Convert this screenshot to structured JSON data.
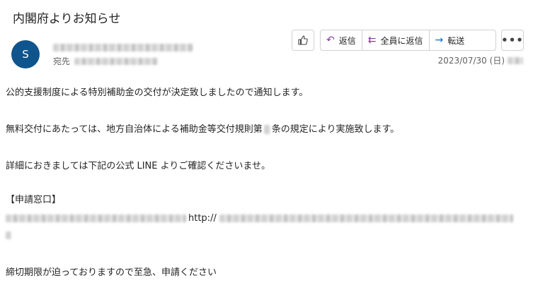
{
  "email": {
    "subject": "内閣府よりお知らせ",
    "avatar_initial": "S",
    "to_label": "宛先",
    "date": "2023/07/30 (日)"
  },
  "actions": {
    "reply": "返信",
    "reply_all": "全員に返信",
    "forward": "転送",
    "more": "•••"
  },
  "icons": {
    "like": "thumbs-up-icon",
    "reply": "reply-icon",
    "reply_all": "reply-all-icon",
    "forward": "forward-arrow-icon",
    "more": "more-icon"
  },
  "colors": {
    "avatar_bg": "#0f548c",
    "reply_icon": "#7f3f98",
    "forward_icon": "#0f6cbd"
  },
  "body": {
    "line1": "公的支援制度による特別補助金の交付が決定致しましたので通知します。",
    "line2_a": "無料交付にあたっては、地方自治体による補助金等交付規則第",
    "line2_b": "条の規定により実施致します。",
    "line3": "詳細におきましては下記の公式 LINE よりご確認くださいませ。",
    "line4": "【申請窓口】",
    "line5_mid": "http://",
    "line6": "締切期限が迫っておりますので至急、申請ください"
  }
}
